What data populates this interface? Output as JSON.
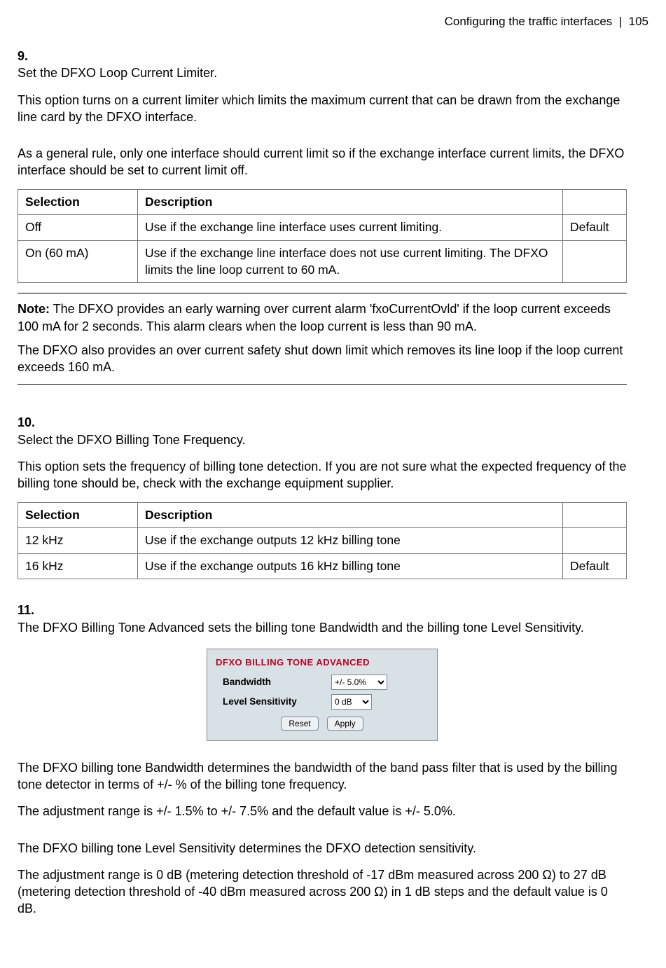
{
  "header": {
    "section": "Configuring the traffic interfaces",
    "sep": "|",
    "page": "105"
  },
  "step9": {
    "num": "9.",
    "title": "Set the DFXO Loop Current Limiter.",
    "p1": "This option turns on a current limiter which limits the maximum current that can be drawn from the exchange line card by the DFXO interface.",
    "p2": "As a general rule, only one interface should current limit so if the exchange interface current limits, the DFXO interface should be set to current limit off.",
    "th1": "Selection",
    "th2": "Description",
    "th3": "",
    "r1c1": "Off",
    "r1c2": "Use if the exchange line interface uses current limiting.",
    "r1c3": "Default",
    "r2c1": "On (60 mA)",
    "r2c2": "Use if the exchange line interface does not use current limiting. The DFXO limits the line loop current to 60 mA.",
    "r2c3": "",
    "note_label": "Note:",
    "note_p1": " The DFXO provides an early warning over current alarm 'fxoCurrentOvld' if the loop current exceeds 100 mA for 2 seconds. This alarm clears when the loop current is less than 90 mA.",
    "note_p2": "The DFXO also provides an over current safety shut down limit which removes its line loop if the loop current exceeds 160 mA."
  },
  "step10": {
    "num": "10.",
    "title": "Select the DFXO Billing Tone Frequency.",
    "p1": "This option sets the frequency of billing tone detection. If you are not sure what the expected frequency of the billing tone should be, check with the exchange equipment supplier.",
    "th1": "Selection",
    "th2": "Description",
    "th3": "",
    "r1c1": "12 kHz",
    "r1c2": "Use if the exchange outputs 12 kHz billing tone",
    "r1c3": "",
    "r2c1": "16 kHz",
    "r2c2": "Use if the exchange outputs 16 kHz billing tone",
    "r2c3": "Default"
  },
  "step11": {
    "num": "11.",
    "title": "The DFXO Billing Tone Advanced sets the billing tone Bandwidth and the billing tone Level Sensitivity.",
    "widget": {
      "title": "DFXO BILLING TONE ADVANCED",
      "row1_label": "Bandwidth",
      "row1_value": "+/- 5.0%",
      "row2_label": "Level Sensitivity",
      "row2_value": "0 dB",
      "reset": "Reset",
      "apply": "Apply"
    },
    "p1": "The DFXO billing tone Bandwidth determines the bandwidth of the band pass filter that is used by the billing tone detector in terms of +/- % of the billing tone frequency.",
    "p2": "The adjustment range is +/- 1.5% to +/- 7.5% and the default value is +/- 5.0%.",
    "p3": "The DFXO billing tone Level Sensitivity determines the DFXO detection sensitivity.",
    "p4": "The adjustment range is 0 dB (metering detection threshold of -17 dBm measured across 200 Ω) to 27 dB (metering detection threshold of -40 dBm measured across 200 Ω) in 1 dB steps and the default value is 0 dB."
  }
}
